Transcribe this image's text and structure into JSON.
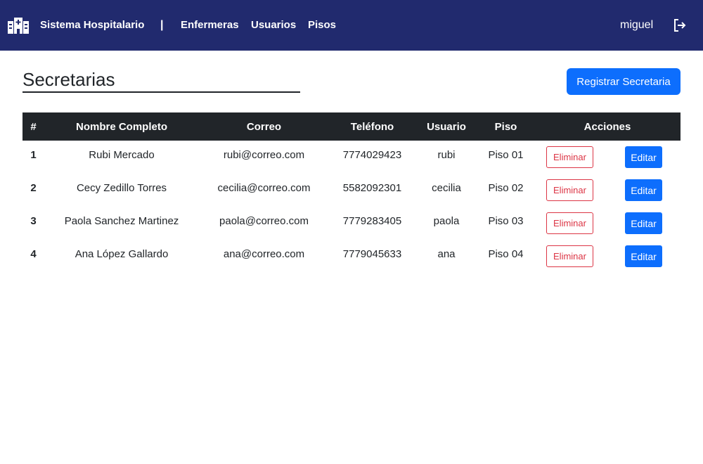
{
  "navbar": {
    "brand": "Sistema Hospitalario",
    "separator": "|",
    "links": [
      "Enfermeras",
      "Usuarios",
      "Pisos"
    ],
    "user": "miguel",
    "brand_icon": "hospital-icon",
    "logout_icon": "logout-icon",
    "background_color": "#212a6e"
  },
  "page": {
    "title": "Secretarias",
    "register_button": "Registrar Secretaria"
  },
  "table": {
    "headers": [
      "#",
      "Nombre Completo",
      "Correo",
      "Teléfono",
      "Usuario",
      "Piso",
      "Acciones"
    ],
    "rows": [
      {
        "num": "1",
        "name": "Rubi Mercado",
        "email": "rubi@correo.com",
        "phone": "7774029423",
        "user": "rubi",
        "floor": "Piso 01"
      },
      {
        "num": "2",
        "name": "Cecy Zedillo Torres",
        "email": "cecilia@correo.com",
        "phone": "5582092301",
        "user": "cecilia",
        "floor": "Piso 02"
      },
      {
        "num": "3",
        "name": "Paola Sanchez Martinez",
        "email": "paola@correo.com",
        "phone": "7779283405",
        "user": "paola",
        "floor": "Piso 03"
      },
      {
        "num": "4",
        "name": "Ana López Gallardo",
        "email": "ana@correo.com",
        "phone": "7779045633",
        "user": "ana",
        "floor": "Piso 04"
      }
    ],
    "delete_label": "Eliminar",
    "edit_label": "Editar",
    "header_color": "#212529",
    "primary_color": "#0d6efd",
    "danger_color": "#dc3545"
  }
}
